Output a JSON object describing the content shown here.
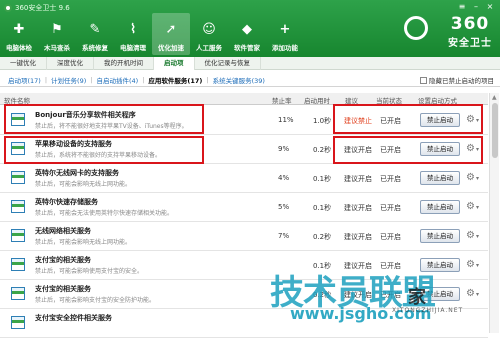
{
  "app": {
    "title": "360安全卫士 9.6"
  },
  "nav": [
    {
      "label": "电脑体检",
      "icon": "computer-check-icon",
      "glyph": "✚"
    },
    {
      "label": "木马查杀",
      "icon": "trojan-scan-icon",
      "glyph": "⚑"
    },
    {
      "label": "系统修复",
      "icon": "wrench-icon",
      "glyph": "✎"
    },
    {
      "label": "电脑清理",
      "icon": "broom-icon",
      "glyph": "⌇"
    },
    {
      "label": "优化加速",
      "icon": "rocket-icon",
      "glyph": "➚"
    },
    {
      "label": "人工服务",
      "icon": "person-service-icon",
      "glyph": "☺"
    },
    {
      "label": "软件管家",
      "icon": "software-bag-icon",
      "glyph": "◆"
    },
    {
      "label": "添加功能",
      "icon": "plus-icon",
      "glyph": "+"
    }
  ],
  "nav_active": 4,
  "brand": {
    "big": "360",
    "small": "安全卫士"
  },
  "tabs1": [
    "一键优化",
    "深度优化",
    "我的开机时间",
    "启动项",
    "优化记录与恢复"
  ],
  "tabs1_active": 3,
  "tabs2": [
    {
      "label": "启动项(17)"
    },
    {
      "label": "计划任务(9)"
    },
    {
      "label": "自启动插件(4)"
    },
    {
      "label": "应用软件服务(17)"
    },
    {
      "label": "系统关键服务(39)"
    }
  ],
  "tabs2_active": 3,
  "hide_label": "隐藏已禁止启动的项目",
  "columns": {
    "name": "软件名称",
    "rate": "禁止率",
    "time": "启动用时",
    "suggest": "建议",
    "status": "当前状态",
    "method": "设置启动方式"
  },
  "rows": [
    {
      "name": "Bonjour音乐分享软件相关程序",
      "desc": "禁止后，将不能很好地支持苹果TV设备、iTunes等程序。",
      "rate": "11%",
      "time": "1.0秒",
      "suggest": "建议禁止",
      "warn": true,
      "status": "已开启",
      "button": "禁止启动"
    },
    {
      "name": "苹果移动设备的支持服务",
      "desc": "禁止后，系统将不能很好的支持苹果移动设备。",
      "rate": "9%",
      "time": "0.2秒",
      "suggest": "建议开启",
      "warn": false,
      "status": "已开启",
      "button": "禁止启动"
    },
    {
      "name": "英特尔无线网卡的支持服务",
      "desc": "禁止后，可能会影响无线上网功能。",
      "rate": "4%",
      "time": "0.1秒",
      "suggest": "建议开启",
      "warn": false,
      "status": "已开启",
      "button": "禁止启动"
    },
    {
      "name": "英特尔快速存储服务",
      "desc": "禁止后，可能会无法使用英特尔快速存储相关功能。",
      "rate": "5%",
      "time": "0.1秒",
      "suggest": "建议开启",
      "warn": false,
      "status": "已开启",
      "button": "禁止启动"
    },
    {
      "name": "无线网络相关服务",
      "desc": "禁止后，可能会影响无线上网功能。",
      "rate": "7%",
      "time": "0.2秒",
      "suggest": "建议开启",
      "warn": false,
      "status": "已开启",
      "button": "禁止启动"
    },
    {
      "name": "支付宝的相关服务",
      "desc": "禁止后，可能会影响使用支付宝的安全。",
      "rate": "",
      "time": "0.1秒",
      "suggest": "建议开启",
      "warn": false,
      "status": "已开启",
      "button": "禁止启动"
    },
    {
      "name": "支付宝的相关服务",
      "desc": "禁止后，可能会影响支付宝的安全防护功能。",
      "rate": "",
      "time": "0.2秒",
      "suggest": "建议开启",
      "warn": false,
      "status": "已开启",
      "button": "禁止启动"
    },
    {
      "name": "支付宝安全控件相关服务",
      "desc": "",
      "rate": "",
      "time": "",
      "suggest": "",
      "warn": false,
      "status": "",
      "button": ""
    }
  ],
  "watermark": {
    "main": "技术员联盟",
    "home": "家",
    "url": "www.jsgho.com",
    "sub": "XITONGZHIJIA.NET"
  }
}
